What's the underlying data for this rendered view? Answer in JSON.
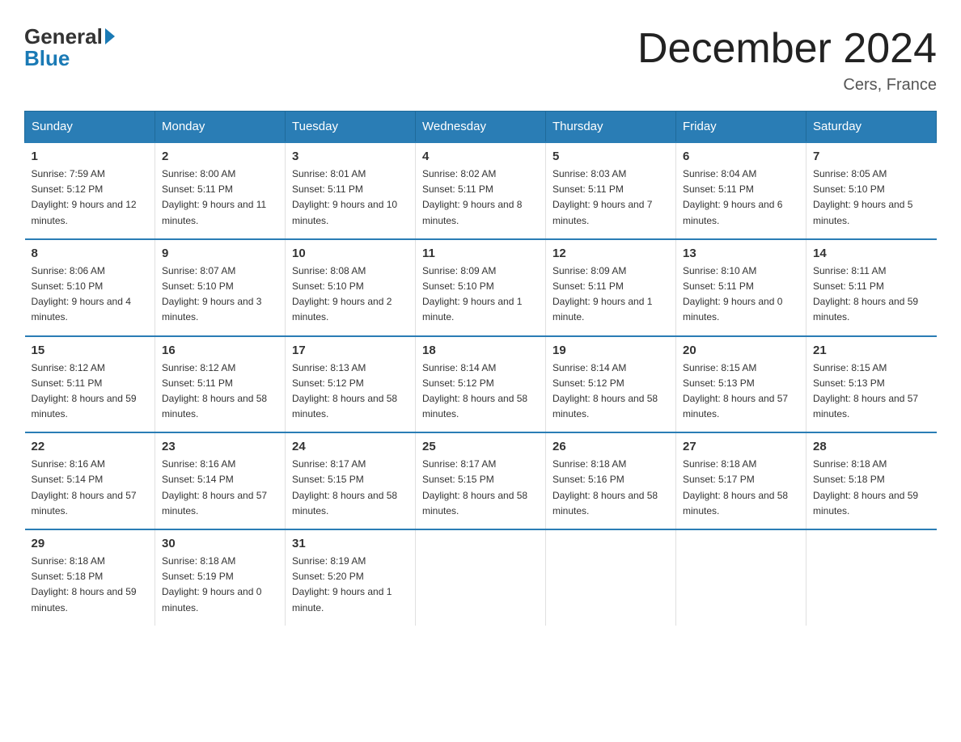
{
  "logo": {
    "general": "General",
    "blue": "Blue"
  },
  "header": {
    "title": "December 2024",
    "location": "Cers, France"
  },
  "days_of_week": [
    "Sunday",
    "Monday",
    "Tuesday",
    "Wednesday",
    "Thursday",
    "Friday",
    "Saturday"
  ],
  "weeks": [
    [
      {
        "day": "1",
        "sunrise": "7:59 AM",
        "sunset": "5:12 PM",
        "daylight": "9 hours and 12 minutes."
      },
      {
        "day": "2",
        "sunrise": "8:00 AM",
        "sunset": "5:11 PM",
        "daylight": "9 hours and 11 minutes."
      },
      {
        "day": "3",
        "sunrise": "8:01 AM",
        "sunset": "5:11 PM",
        "daylight": "9 hours and 10 minutes."
      },
      {
        "day": "4",
        "sunrise": "8:02 AM",
        "sunset": "5:11 PM",
        "daylight": "9 hours and 8 minutes."
      },
      {
        "day": "5",
        "sunrise": "8:03 AM",
        "sunset": "5:11 PM",
        "daylight": "9 hours and 7 minutes."
      },
      {
        "day": "6",
        "sunrise": "8:04 AM",
        "sunset": "5:11 PM",
        "daylight": "9 hours and 6 minutes."
      },
      {
        "day": "7",
        "sunrise": "8:05 AM",
        "sunset": "5:10 PM",
        "daylight": "9 hours and 5 minutes."
      }
    ],
    [
      {
        "day": "8",
        "sunrise": "8:06 AM",
        "sunset": "5:10 PM",
        "daylight": "9 hours and 4 minutes."
      },
      {
        "day": "9",
        "sunrise": "8:07 AM",
        "sunset": "5:10 PM",
        "daylight": "9 hours and 3 minutes."
      },
      {
        "day": "10",
        "sunrise": "8:08 AM",
        "sunset": "5:10 PM",
        "daylight": "9 hours and 2 minutes."
      },
      {
        "day": "11",
        "sunrise": "8:09 AM",
        "sunset": "5:10 PM",
        "daylight": "9 hours and 1 minute."
      },
      {
        "day": "12",
        "sunrise": "8:09 AM",
        "sunset": "5:11 PM",
        "daylight": "9 hours and 1 minute."
      },
      {
        "day": "13",
        "sunrise": "8:10 AM",
        "sunset": "5:11 PM",
        "daylight": "9 hours and 0 minutes."
      },
      {
        "day": "14",
        "sunrise": "8:11 AM",
        "sunset": "5:11 PM",
        "daylight": "8 hours and 59 minutes."
      }
    ],
    [
      {
        "day": "15",
        "sunrise": "8:12 AM",
        "sunset": "5:11 PM",
        "daylight": "8 hours and 59 minutes."
      },
      {
        "day": "16",
        "sunrise": "8:12 AM",
        "sunset": "5:11 PM",
        "daylight": "8 hours and 58 minutes."
      },
      {
        "day": "17",
        "sunrise": "8:13 AM",
        "sunset": "5:12 PM",
        "daylight": "8 hours and 58 minutes."
      },
      {
        "day": "18",
        "sunrise": "8:14 AM",
        "sunset": "5:12 PM",
        "daylight": "8 hours and 58 minutes."
      },
      {
        "day": "19",
        "sunrise": "8:14 AM",
        "sunset": "5:12 PM",
        "daylight": "8 hours and 58 minutes."
      },
      {
        "day": "20",
        "sunrise": "8:15 AM",
        "sunset": "5:13 PM",
        "daylight": "8 hours and 57 minutes."
      },
      {
        "day": "21",
        "sunrise": "8:15 AM",
        "sunset": "5:13 PM",
        "daylight": "8 hours and 57 minutes."
      }
    ],
    [
      {
        "day": "22",
        "sunrise": "8:16 AM",
        "sunset": "5:14 PM",
        "daylight": "8 hours and 57 minutes."
      },
      {
        "day": "23",
        "sunrise": "8:16 AM",
        "sunset": "5:14 PM",
        "daylight": "8 hours and 57 minutes."
      },
      {
        "day": "24",
        "sunrise": "8:17 AM",
        "sunset": "5:15 PM",
        "daylight": "8 hours and 58 minutes."
      },
      {
        "day": "25",
        "sunrise": "8:17 AM",
        "sunset": "5:15 PM",
        "daylight": "8 hours and 58 minutes."
      },
      {
        "day": "26",
        "sunrise": "8:18 AM",
        "sunset": "5:16 PM",
        "daylight": "8 hours and 58 minutes."
      },
      {
        "day": "27",
        "sunrise": "8:18 AM",
        "sunset": "5:17 PM",
        "daylight": "8 hours and 58 minutes."
      },
      {
        "day": "28",
        "sunrise": "8:18 AM",
        "sunset": "5:18 PM",
        "daylight": "8 hours and 59 minutes."
      }
    ],
    [
      {
        "day": "29",
        "sunrise": "8:18 AM",
        "sunset": "5:18 PM",
        "daylight": "8 hours and 59 minutes."
      },
      {
        "day": "30",
        "sunrise": "8:18 AM",
        "sunset": "5:19 PM",
        "daylight": "9 hours and 0 minutes."
      },
      {
        "day": "31",
        "sunrise": "8:19 AM",
        "sunset": "5:20 PM",
        "daylight": "9 hours and 1 minute."
      },
      null,
      null,
      null,
      null
    ]
  ],
  "labels": {
    "sunrise": "Sunrise:",
    "sunset": "Sunset:",
    "daylight": "Daylight:"
  }
}
